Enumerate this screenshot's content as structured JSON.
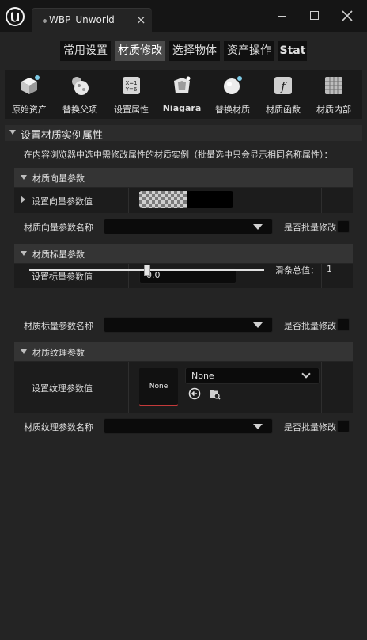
{
  "window": {
    "tab_title": "WBP_Unworld",
    "close_glyph": "×"
  },
  "top_tabs": [
    {
      "label": "常用设置",
      "active": false
    },
    {
      "label": "材质修改",
      "active": true
    },
    {
      "label": "选择物体",
      "active": false
    },
    {
      "label": "资产操作",
      "active": false
    },
    {
      "label": "Stat",
      "active": false
    }
  ],
  "tools": [
    {
      "label": "原始资产",
      "icon": "cube-icon"
    },
    {
      "label": "替换父项",
      "icon": "sphere-replace-icon"
    },
    {
      "label": "设置属性",
      "icon": "formula-icon",
      "selected": true
    },
    {
      "label": "Niagara",
      "icon": "niagara-icon"
    },
    {
      "label": "替换材质",
      "icon": "material-sphere-icon"
    },
    {
      "label": "材质函数",
      "icon": "function-icon"
    },
    {
      "label": "材质内部",
      "icon": "grid-icon"
    }
  ],
  "section": {
    "title": "设置材质实例属性",
    "info": "在内容浏览器中选中需修改属性的材质实例（批量选中只会显示相同名称属性）："
  },
  "vector_group": {
    "title": "材质向量参数",
    "set_label": "设置向量参数值",
    "name_label": "材质向量参数名称",
    "batch_label": "是否批量修改"
  },
  "scalar_group": {
    "title": "材质标量参数",
    "set_label": "设置标量参数值",
    "value": "0.0",
    "slider_label": "滑条总值：",
    "slider_value": "1",
    "slider_fraction": 0.5,
    "name_label": "材质标量参数名称",
    "batch_label": "是否批量修改"
  },
  "texture_group": {
    "title": "材质纹理参数",
    "set_label": "设置纹理参数值",
    "thumb_text": "None",
    "select_value": "None",
    "name_label": "材质纹理参数名称",
    "batch_label": "是否批量修改"
  },
  "colors": {
    "panel": "#242424",
    "title_bar": "#151515",
    "accent_red": "#c43a3a"
  }
}
